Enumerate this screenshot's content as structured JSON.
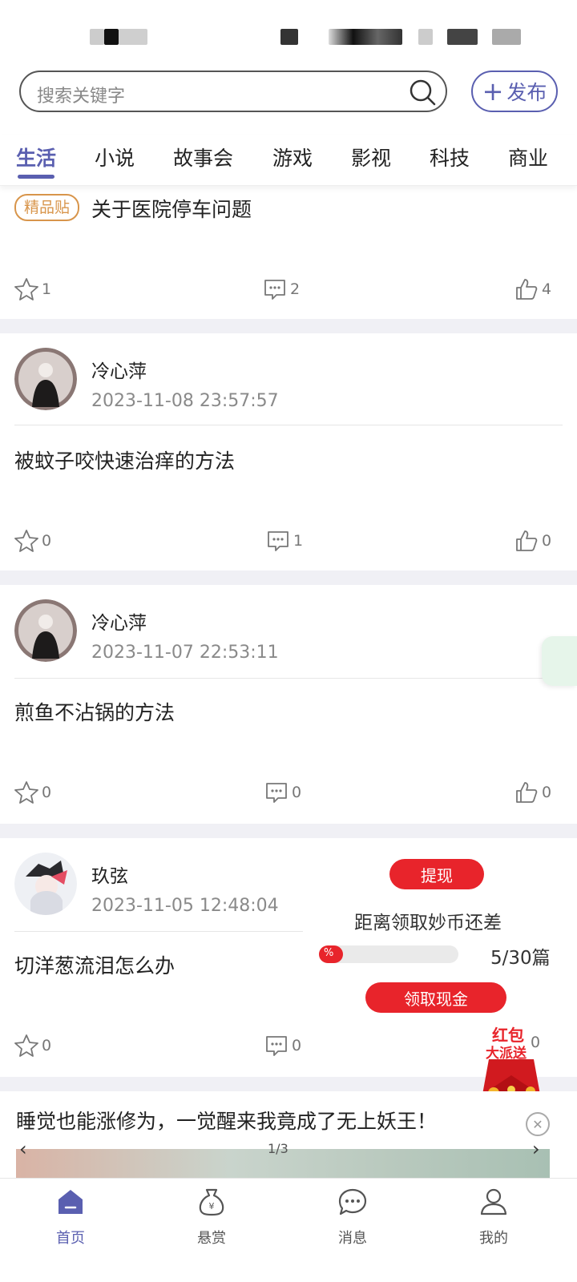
{
  "search": {
    "placeholder": "搜索关键字"
  },
  "publish": {
    "label": "发布"
  },
  "tabs": [
    "生活",
    "小说",
    "故事会",
    "游戏",
    "影视",
    "科技",
    "商业"
  ],
  "active_tab": "生活",
  "posts": [
    {
      "badge": "精品贴",
      "title": "关于医院停车问题",
      "stars": "1",
      "comments": "2",
      "likes": "4"
    },
    {
      "author": "冷心萍",
      "time": "2023-11-08 23:57:57",
      "title": "被蚊子咬快速治痒的方法",
      "stars": "0",
      "comments": "1",
      "likes": "0"
    },
    {
      "author": "冷心萍",
      "time": "2023-11-07 22:53:11",
      "title": "煎鱼不沾锅的方法",
      "stars": "0",
      "comments": "0",
      "likes": "0"
    },
    {
      "author": "玖弦",
      "time": "2023-11-05 12:48:04",
      "title": "切洋葱流泪怎么办",
      "stars": "0",
      "comments": "0",
      "likes": "0"
    }
  ],
  "promo": {
    "withdraw_label": "提现",
    "text": "距离领取妙币还差",
    "progress_symbol": "%",
    "progress_fraction": 0.17,
    "count": "5/30篇",
    "cash_label": "领取现金",
    "redpacket_line1": "红包",
    "redpacket_line2": "大派送"
  },
  "ad": {
    "title": "睡觉也能涨修为，一觉醒来我竟成了无上妖王！",
    "page": "1/3",
    "close": "✕"
  },
  "bottom_nav": [
    {
      "label": "首页",
      "icon": "home-icon"
    },
    {
      "label": "悬赏",
      "icon": "money-bag-icon"
    },
    {
      "label": "消息",
      "icon": "message-icon"
    },
    {
      "label": "我的",
      "icon": "profile-icon"
    }
  ],
  "colors": {
    "accent": "#5a5fb0",
    "red": "#e8242b",
    "badge": "#d8954b"
  }
}
